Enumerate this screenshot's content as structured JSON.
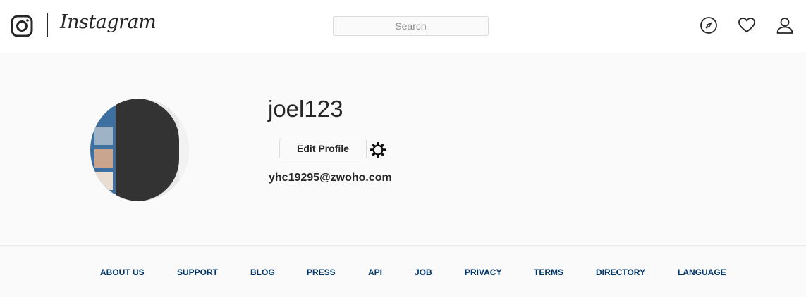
{
  "header": {
    "brand": "Instagram",
    "search_placeholder": "Search",
    "icons": {
      "logo": "instagram-camera-icon",
      "explore": "compass-icon",
      "activity": "heart-icon",
      "profile": "user-icon"
    }
  },
  "profile": {
    "username": "joel123",
    "edit_button": "Edit Profile",
    "settings_icon": "gear-icon",
    "email": "yhc19295@zwoho.com"
  },
  "footer": {
    "links": [
      "ABOUT US",
      "SUPPORT",
      "BLOG",
      "PRESS",
      "API",
      "JOB",
      "PRIVACY",
      "TERMS",
      "DIRECTORY",
      "LANGUAGE"
    ]
  },
  "colors": {
    "text": "#262626",
    "link": "#003569",
    "border": "#dbdbdb",
    "background": "#fafafa"
  }
}
